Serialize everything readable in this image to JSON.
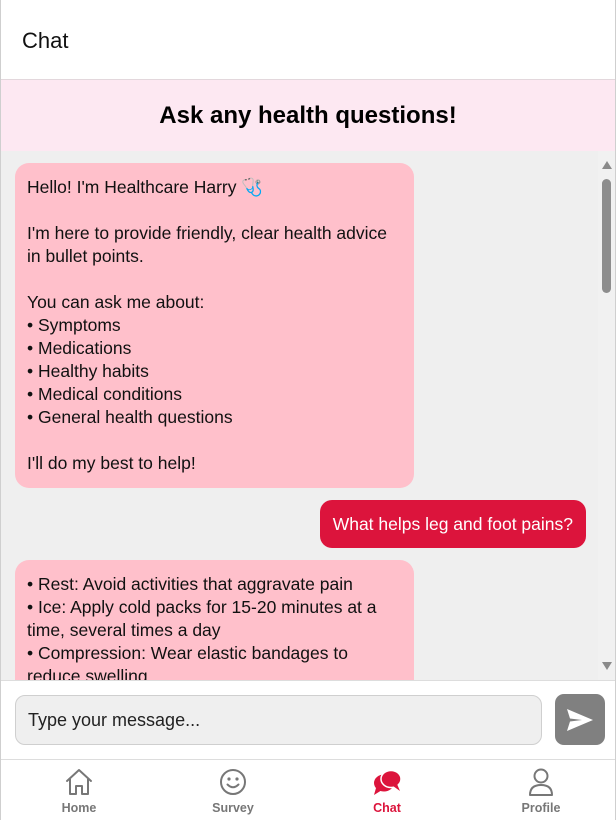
{
  "header": {
    "title": "Chat"
  },
  "banner": {
    "heading": "Ask any health questions!"
  },
  "messages": [
    {
      "role": "bot",
      "text": "Hello! I'm Healthcare Harry 🩺\n\nI'm here to provide friendly, clear health advice in bullet points.\n\nYou can ask me about:\n• Symptoms\n• Medications\n• Healthy habits\n• Medical conditions\n• General health questions\n\nI'll do my best to help!"
    },
    {
      "role": "user",
      "text": "What helps leg and foot pains?"
    },
    {
      "role": "bot",
      "text": "• Rest: Avoid activities that aggravate pain\n• Ice: Apply cold packs for 15-20 minutes at a time, several times a day\n• Compression: Wear elastic bandages to reduce swelling"
    }
  ],
  "composer": {
    "placeholder": "Type your message...",
    "send_icon": "send-arrow-icon"
  },
  "nav": {
    "items": [
      {
        "label": "Home",
        "icon": "home-icon"
      },
      {
        "label": "Survey",
        "icon": "smiley-icon"
      },
      {
        "label": "Chat",
        "icon": "chat-bubbles-icon",
        "active": true
      },
      {
        "label": "Profile",
        "icon": "person-icon"
      }
    ]
  },
  "colors": {
    "accent": "#dc143c",
    "bot_bubble": "#ffc0cb",
    "banner_bg": "#fde8f2",
    "chat_bg": "#efefef"
  }
}
